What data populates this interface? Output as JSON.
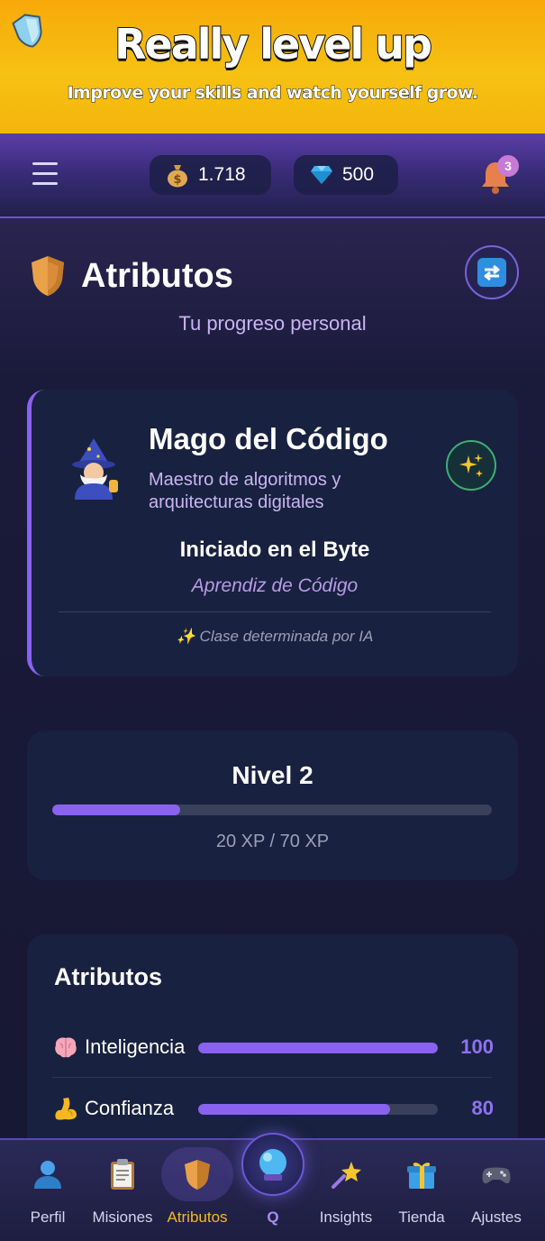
{
  "banner": {
    "title": "Really level up",
    "subtitle": "Improve your skills and watch yourself grow.",
    "icon": "shield-icon"
  },
  "topbar": {
    "gold_amount": "1.718",
    "gem_amount": "500",
    "notification_count": "3",
    "icons": [
      "menu-icon",
      "money-bag-icon",
      "diamond-icon",
      "bell-icon"
    ]
  },
  "header": {
    "title": "Atributos",
    "subtitle": "Tu progreso personal",
    "icons": [
      "shield-icon",
      "refresh-icon"
    ]
  },
  "class_card": {
    "name": "Mago del Código",
    "description": "Maestro de algoritmos y arquitecturas digitales",
    "rank": "Iniciado en el Byte",
    "rank_subtitle": "Aprendiz de Código",
    "ai_note": "✨ Clase determinada por IA",
    "icons": [
      "wizard-icon",
      "sparkles-icon"
    ]
  },
  "level": {
    "title": "Nivel 2",
    "xp_text": "20 XP / 70 XP",
    "progress_percent": 29
  },
  "attributes": {
    "title": "Atributos",
    "items": [
      {
        "emoji": "brain-icon",
        "label": "Inteligencia",
        "value": "100",
        "progress_percent": 100
      },
      {
        "emoji": "flexed-biceps-icon",
        "label": "Confianza",
        "value": "80",
        "progress_percent": 80
      }
    ]
  },
  "nav": {
    "items": [
      {
        "label": "Perfil",
        "icon": "user-icon"
      },
      {
        "label": "Misiones",
        "icon": "clipboard-icon"
      },
      {
        "label": "Atributos",
        "icon": "shield-icon",
        "active": true
      },
      {
        "label": "Q",
        "icon": "crystal-ball-icon"
      },
      {
        "label": "Insights",
        "icon": "shooting-star-icon"
      },
      {
        "label": "Tienda",
        "icon": "gift-icon"
      },
      {
        "label": "Ajustes",
        "icon": "gamepad-icon"
      }
    ]
  },
  "colors": {
    "accent": "#8a62f0",
    "banner": "#f6c112",
    "active_nav": "#f5b820",
    "card_bg": "#18213f"
  }
}
